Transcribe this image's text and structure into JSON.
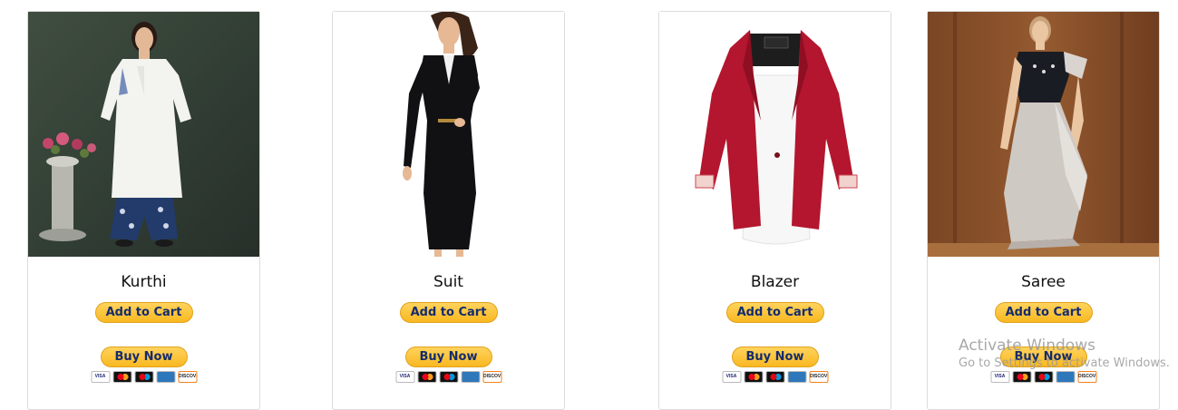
{
  "products": [
    {
      "name": "Kurthi",
      "add_to_cart": "Add to Cart",
      "buy_now": "Buy Now"
    },
    {
      "name": "Suit",
      "add_to_cart": "Add to Cart",
      "buy_now": "Buy Now"
    },
    {
      "name": "Blazer",
      "add_to_cart": "Add to Cart",
      "buy_now": "Buy Now"
    },
    {
      "name": "Saree",
      "add_to_cart": "Add to Cart",
      "buy_now": "Buy Now"
    }
  ],
  "payment_cards": [
    "VISA",
    "Mastercard",
    "Maestro",
    "American Express",
    "DISCOVER"
  ],
  "watermark": {
    "title": "Activate Windows",
    "subtitle": "Go to Settings to activate Windows."
  },
  "colors": {
    "button_fill": "#f9b821",
    "button_text": "#142c6e",
    "card_border": "#dcdcdc"
  }
}
